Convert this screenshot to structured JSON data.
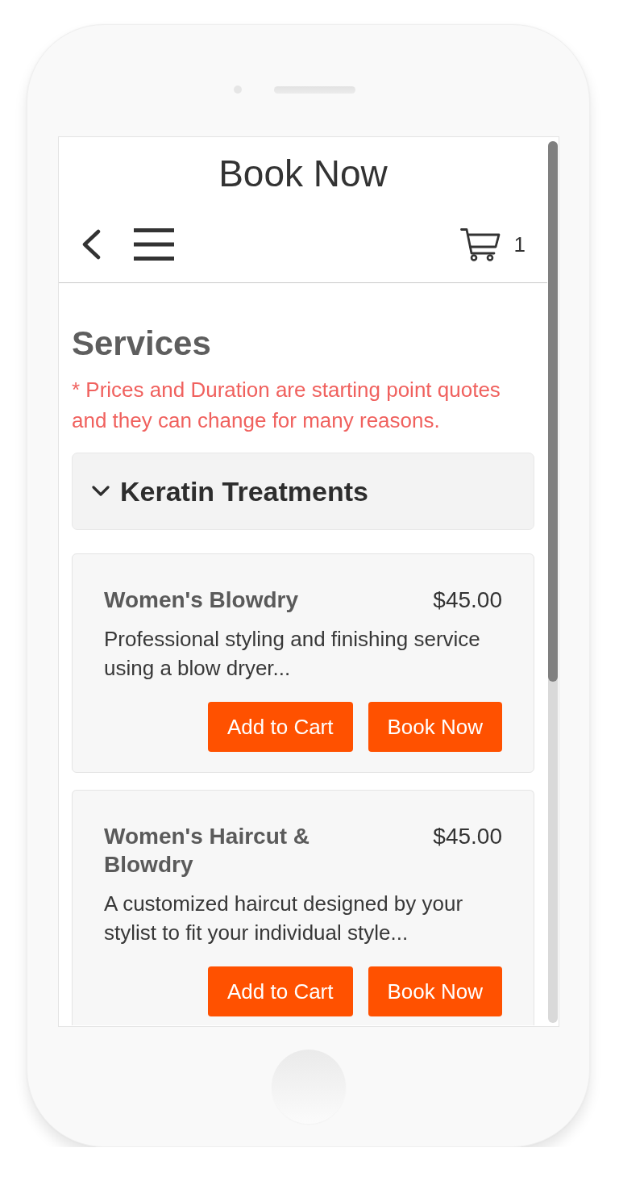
{
  "header": {
    "title": "Book Now",
    "cart_count": "1"
  },
  "section": {
    "heading": "Services",
    "note": "* Prices and Duration are starting point quotes and they can change for many reasons."
  },
  "category": {
    "name": "Keratin Treatments",
    "expanded": true
  },
  "services": [
    {
      "name": "Women's Blowdry",
      "price": "$45.00",
      "description": "Professional styling and finishing service using a blow dryer...",
      "buttons": [
        "Add to Cart",
        "Book Now"
      ]
    },
    {
      "name": "Women's Haircut & Blowdry",
      "price": "$45.00",
      "description": "A customized haircut designed by your stylist to fit your individual style...",
      "buttons": [
        "Add to Cart",
        "Book Now"
      ]
    }
  ]
}
